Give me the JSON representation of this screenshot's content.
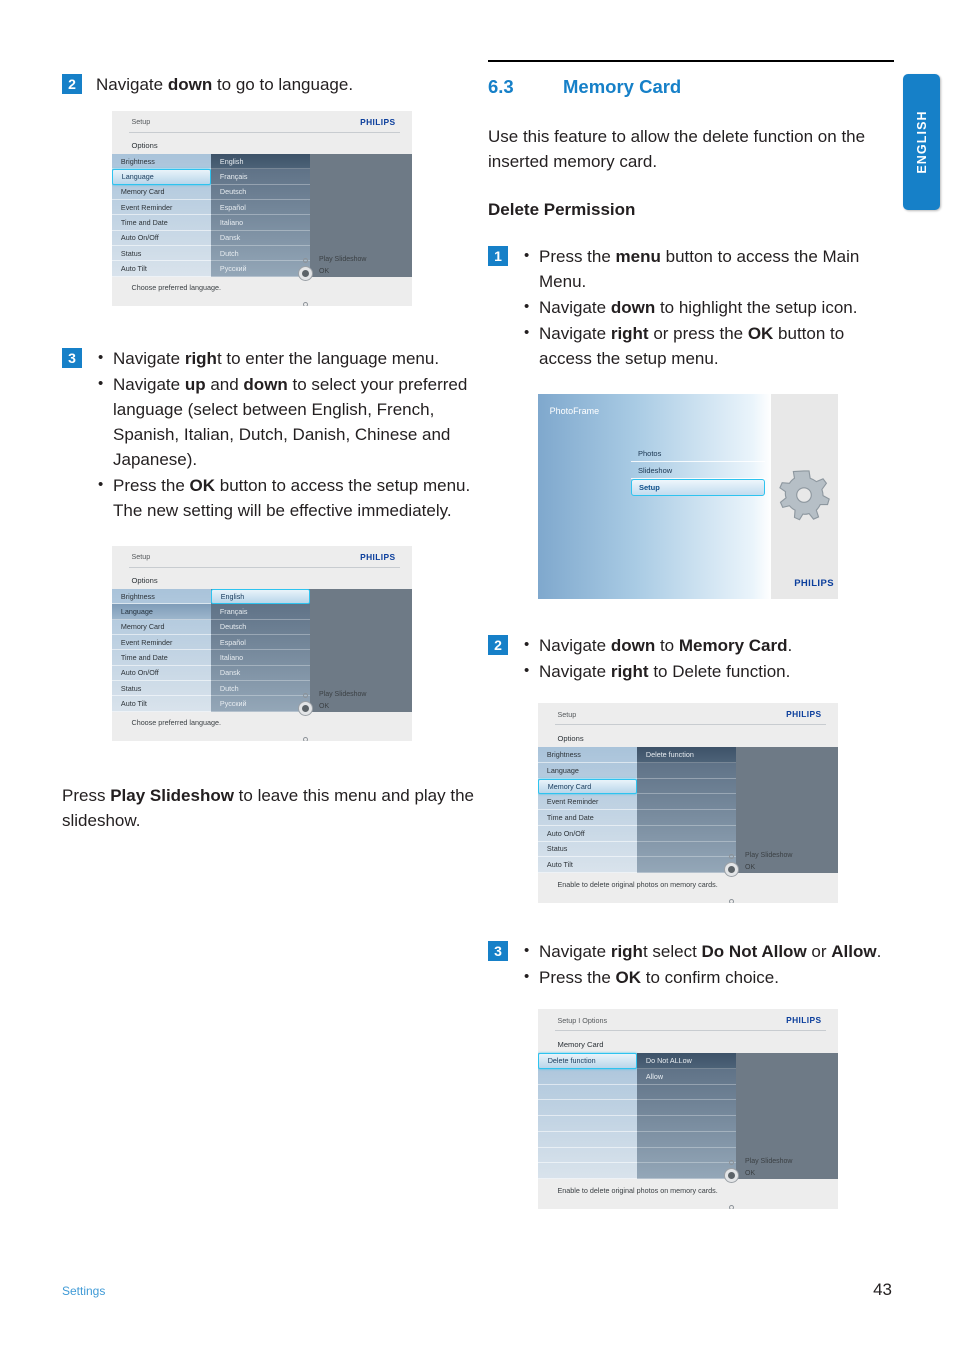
{
  "language_tab": {
    "label": "ENGLISH"
  },
  "footer": {
    "section": "Settings",
    "page": "43"
  },
  "left_column": {
    "step2": {
      "number": "2",
      "text_parts": [
        "Navigate ",
        "down",
        " to go to language."
      ]
    },
    "shot_language_nav": {
      "title": "Setup",
      "brand": "PHILIPS",
      "headline": "Options",
      "menu_items": [
        "Brightness",
        "Language",
        "Memory Card",
        "Event Reminder",
        "Time and Date",
        "Auto On/Off",
        "Status",
        "Auto Tilt"
      ],
      "selected_item": "Language",
      "language_items": [
        "English",
        "Français",
        "Deutsch",
        "Español",
        "Italiano",
        "Dansk",
        "Dutch",
        "Русский"
      ],
      "highlighted_language": "English",
      "hint": "Choose preferred language.",
      "nav_labels": {
        "up": "Play Slideshow",
        "ok": "OK"
      }
    },
    "step3": {
      "number": "3",
      "bullets": [
        [
          "Navigate ",
          "righ",
          "t to enter the language menu."
        ],
        [
          "Navigate ",
          "up",
          " and ",
          "down",
          " to select your preferred language (select between English, French, Spanish, Italian, Dutch, Danish, Chinese and Japanese)."
        ],
        [
          "Press the ",
          "OK",
          " button to access the setup menu. The new setting will be effective immediately."
        ]
      ]
    },
    "shot_language_selected": {
      "title": "Setup",
      "brand": "PHILIPS",
      "headline": "Options",
      "menu_items": [
        "Brightness",
        "Language",
        "Memory Card",
        "Event Reminder",
        "Time and Date",
        "Auto On/Off",
        "Status",
        "Auto Tilt"
      ],
      "dim_item": "Language",
      "language_items": [
        "English",
        "Français",
        "Deutsch",
        "Español",
        "Italiano",
        "Dansk",
        "Dutch",
        "Русский"
      ],
      "selected_language": "English",
      "hint": "Choose preferred language.",
      "nav_labels": {
        "up": "Play Slideshow",
        "ok": "OK"
      }
    },
    "closing_paragraph": [
      "Press ",
      "Play Slideshow",
      " to leave this menu and play the slideshow."
    ]
  },
  "right_column": {
    "section": {
      "number": "6.3",
      "title": "Memory Card"
    },
    "intro": "Use this feature to allow the delete function on the inserted memory card.",
    "subheading": "Delete Permission",
    "step1": {
      "number": "1",
      "bullets": [
        [
          "Press the ",
          "menu",
          " button to access the Main Menu."
        ],
        [
          "Navigate ",
          "down",
          " to highlight the setup icon."
        ],
        [
          "Navigate ",
          "right",
          " or press the ",
          "OK",
          " button to access the setup menu."
        ]
      ]
    },
    "shot_main_menu": {
      "title": "PhotoFrame",
      "items": [
        "Photos",
        "Slideshow",
        "Setup"
      ],
      "selected_item": "Setup",
      "brand": "PHILIPS",
      "icon": "gear-icon"
    },
    "step2": {
      "number": "2",
      "bullets": [
        [
          "Navigate ",
          "down",
          " to ",
          "Memory Card",
          "."
        ],
        [
          "Navigate ",
          "right",
          " to Delete function."
        ]
      ]
    },
    "shot_memory_card": {
      "title": "Setup",
      "brand": "PHILIPS",
      "headline": "Options",
      "menu_items": [
        "Brightness",
        "Language",
        "Memory Card",
        "Event Reminder",
        "Time and Date",
        "Auto On/Off",
        "Status",
        "Auto Tilt"
      ],
      "selected_item": "Memory Card",
      "sub_items": [
        "Delete function"
      ],
      "hint": "Enable to delete original photos on memory cards.",
      "nav_labels": {
        "up": "Play Slideshow",
        "ok": "OK"
      }
    },
    "step3": {
      "number": "3",
      "bullets": [
        [
          "Navigate ",
          "righ",
          "t select ",
          "Do Not Allow",
          " or ",
          "Allow",
          "."
        ],
        [
          "Press the ",
          "OK",
          " to confirm choice."
        ]
      ]
    },
    "shot_delete_permission": {
      "title": "Setup I Options",
      "brand": "PHILIPS",
      "headline": "Memory Card",
      "menu_items": [
        "Delete function"
      ],
      "selected_item": "Delete function",
      "options": [
        "Do Not ALLow",
        "Allow"
      ],
      "highlighted_option": "Do Not ALLow",
      "hint": "Enable to delete original photos on memory cards.",
      "nav_labels": {
        "up": "Play Slideshow",
        "ok": "OK"
      }
    }
  }
}
